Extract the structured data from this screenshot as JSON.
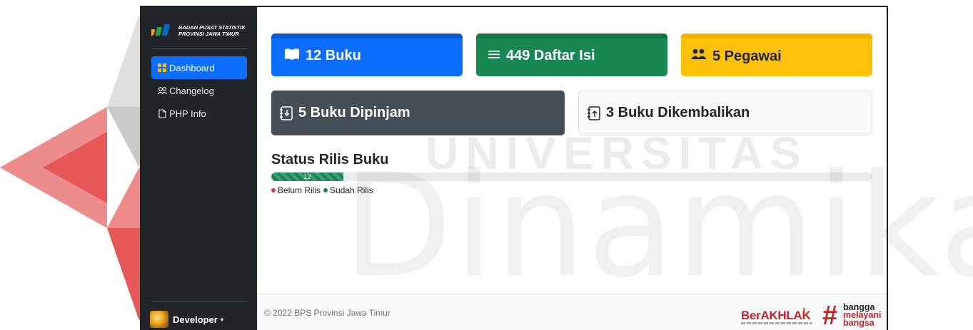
{
  "watermark": {
    "line1": "UNIVERSITAS",
    "line2": "Dinamika"
  },
  "sidebar": {
    "brand": {
      "line1": "BADAN PUSAT STATISTIK",
      "line2": "PROVINSI JAWA TIMUR",
      "icon": "bps-logo"
    },
    "items": [
      {
        "label": "Dashboard",
        "icon": "grid-icon",
        "active": true
      },
      {
        "label": "Changelog",
        "icon": "people-icon",
        "active": false
      },
      {
        "label": "PHP Info",
        "icon": "file-icon",
        "active": false
      }
    ],
    "user": {
      "name": "Developer",
      "icon": "avatar",
      "caret": "▾"
    }
  },
  "cards": {
    "buku": {
      "label": "12 Buku",
      "icon": "book-icon",
      "color": "#0d6efd"
    },
    "daftar_isi": {
      "label": "449 Daftar Isi",
      "icon": "list-icon",
      "color": "#198754"
    },
    "pegawai": {
      "label": "5 Pegawai",
      "icon": "people-icon",
      "color": "#ffc107"
    },
    "dipinjam": {
      "label": "5 Buku Dipinjam",
      "icon": "journal-arrow-down-icon",
      "color": "#454d55"
    },
    "dikembalikan": {
      "label": "3 Buku Dikembalikan",
      "icon": "journal-arrow-up-icon",
      "color": "#f8f9fa"
    }
  },
  "status": {
    "title": "Status Rilis Buku",
    "progress_value": 12,
    "progress_label": "12",
    "progress_fraction": 0.12,
    "legend": [
      {
        "label": "Belum Rilis",
        "color": "#dc3545"
      },
      {
        "label": "Sudah Rilis",
        "color": "#198754"
      }
    ]
  },
  "footer": {
    "copyright": "© 2022 BPS Provinsi Jawa Timur",
    "logo1": "BerAKHLAK",
    "logo2_words": [
      "bangga",
      "melayani",
      "bangsa"
    ]
  }
}
